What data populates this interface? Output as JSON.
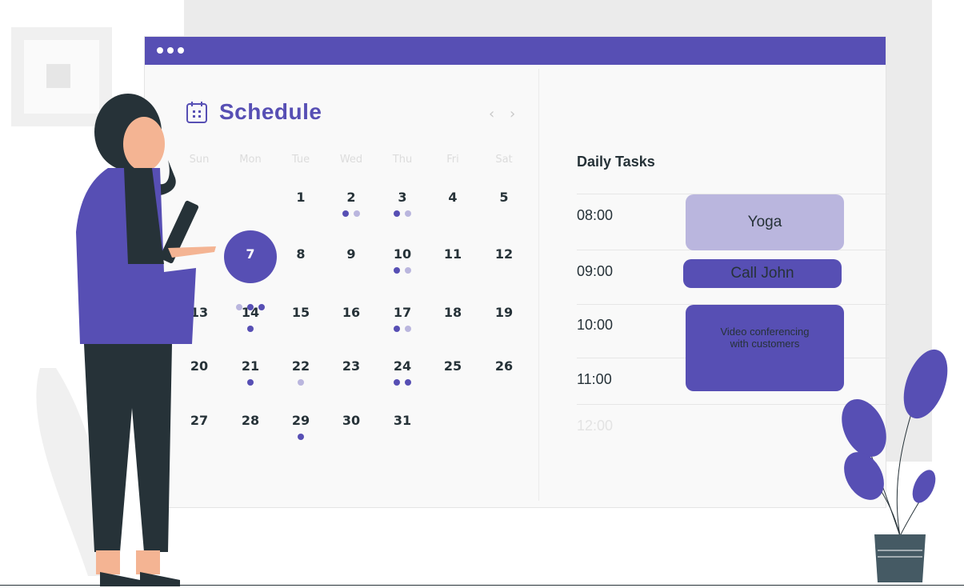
{
  "window": {
    "menu_dots": 3
  },
  "schedule": {
    "title": "Schedule",
    "icon": "calendar-icon",
    "prev": "‹",
    "next": "›",
    "weekdays": [
      "Sun",
      "Mon",
      "Tue",
      "Wed",
      "Thu",
      "Fri",
      "Sat"
    ],
    "selected_day": "7",
    "weeks": [
      [
        null,
        null,
        {
          "d": "1",
          "dots": []
        },
        {
          "d": "2",
          "dots": [
            "dark",
            "light"
          ]
        },
        {
          "d": "3",
          "dots": [
            "dark",
            "light"
          ]
        },
        {
          "d": "4",
          "dots": []
        },
        {
          "d": "5",
          "dots": []
        }
      ],
      [
        null,
        {
          "d": "7",
          "dots": [
            "light",
            "dark",
            "dark"
          ]
        },
        {
          "d": "8",
          "dots": []
        },
        {
          "d": "9",
          "dots": []
        },
        {
          "d": "10",
          "dots": [
            "dark",
            "light"
          ]
        },
        {
          "d": "11",
          "dots": []
        },
        {
          "d": "12",
          "dots": []
        }
      ],
      [
        {
          "d": "13",
          "dots": []
        },
        {
          "d": "14",
          "dots": [
            "dark"
          ]
        },
        {
          "d": "15",
          "dots": []
        },
        {
          "d": "16",
          "dots": []
        },
        {
          "d": "17",
          "dots": [
            "dark",
            "light"
          ]
        },
        {
          "d": "18",
          "dots": []
        },
        {
          "d": "19",
          "dots": []
        }
      ],
      [
        {
          "d": "20",
          "dots": []
        },
        {
          "d": "21",
          "dots": [
            "dark"
          ]
        },
        {
          "d": "22",
          "dots": [
            "light"
          ]
        },
        {
          "d": "23",
          "dots": []
        },
        {
          "d": "24",
          "dots": [
            "dark",
            "dark"
          ]
        },
        {
          "d": "25",
          "dots": []
        },
        {
          "d": "26",
          "dots": []
        }
      ],
      [
        {
          "d": "27",
          "dots": []
        },
        {
          "d": "28",
          "dots": []
        },
        {
          "d": "29",
          "dots": [
            "dark"
          ]
        },
        {
          "d": "30",
          "dots": []
        },
        {
          "d": "31",
          "dots": []
        },
        null,
        null
      ]
    ]
  },
  "daily_tasks": {
    "title": "Daily Tasks",
    "times": [
      "08:00",
      "09:00",
      "10:00",
      "11:00",
      "12:00"
    ],
    "tasks": [
      {
        "label": "Yoga",
        "style": "light"
      },
      {
        "label": "Call John",
        "style": "dark"
      },
      {
        "label": "Video conferencing with customers",
        "style": "dark"
      }
    ]
  },
  "colors": {
    "accent": "#574fb4",
    "accent_light": "#bab6de",
    "text": "#263238",
    "muted": "#dcdcdc"
  }
}
